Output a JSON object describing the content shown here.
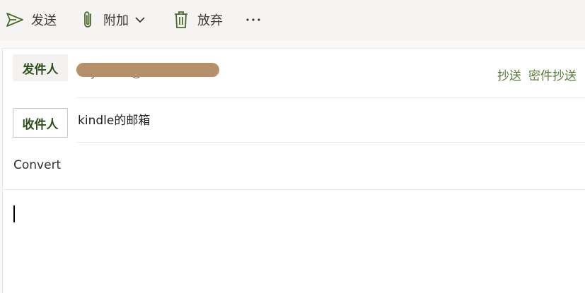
{
  "toolbar": {
    "send_label": "发送",
    "attach_label": "附加",
    "discard_label": "放弃",
    "more_label": "···"
  },
  "compose": {
    "from_label": "发件人",
    "from_value": "thymnos@hotmail.com",
    "cc_label": "抄送",
    "bcc_label": "密件抄送",
    "to_label": "收件人",
    "to_value": "kindle的邮箱",
    "subject_value": "Convert"
  },
  "colors": {
    "accent_green": "#2e4d1a",
    "link_green": "#5b7d39",
    "redaction": "#b5906a"
  }
}
